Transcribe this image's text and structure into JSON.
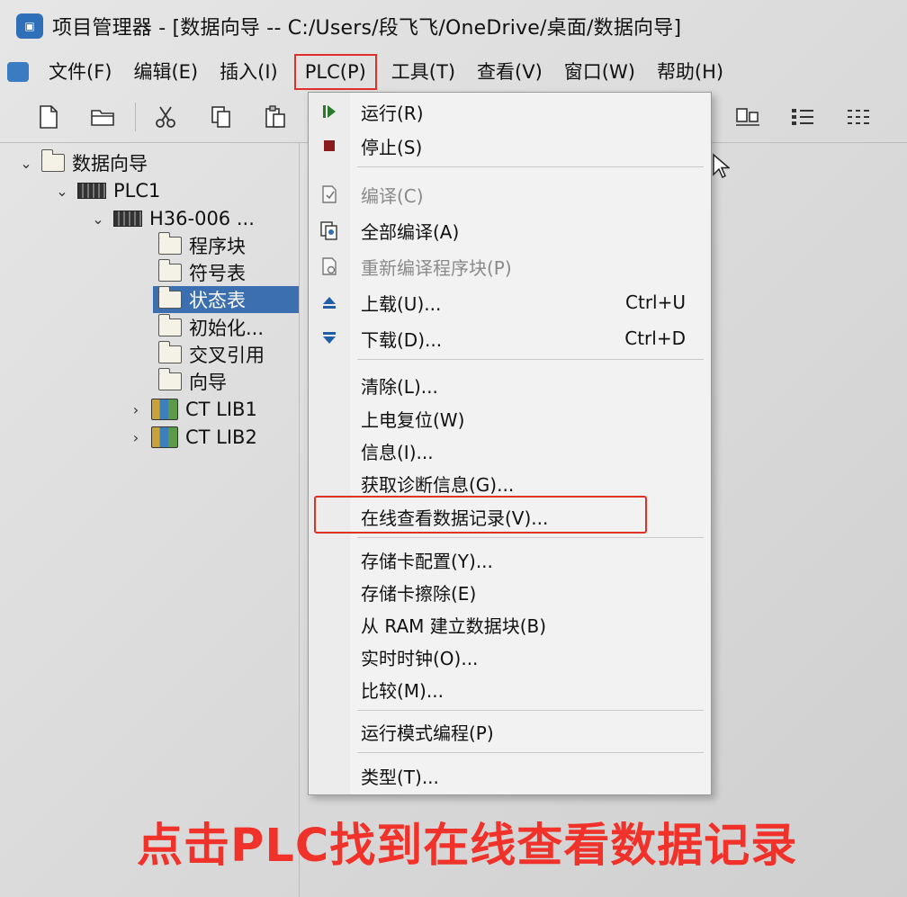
{
  "window": {
    "title": "项目管理器 - [数据向导 -- C:/Users/段飞飞/OneDrive/桌面/数据向导]"
  },
  "menubar": {
    "items": [
      "文件(F)",
      "编辑(E)",
      "插入(I)",
      "PLC(P)",
      "工具(T)",
      "查看(V)",
      "窗口(W)",
      "帮助(H)"
    ],
    "highlighted_item": "PLC(P)"
  },
  "toolbar": {
    "buttons": [
      "new-file-icon",
      "open-folder-icon",
      "cut-icon",
      "copy-icon",
      "paste-icon",
      "tile-view-icon",
      "list-view-icon",
      "details-view-icon"
    ]
  },
  "tree": {
    "items": [
      {
        "label": "数据向导",
        "icon": "folder-icon",
        "expander": "chevron-down-icon"
      },
      {
        "label": "PLC1",
        "icon": "plc-icon",
        "expander": "chevron-down-icon"
      },
      {
        "label": "H36-006 ...",
        "icon": "plc-icon",
        "expander": "chevron-down-icon"
      },
      {
        "label": "程序块",
        "icon": "folder-icon"
      },
      {
        "label": "符号表",
        "icon": "folder-icon"
      },
      {
        "label": "状态表",
        "icon": "folder-icon",
        "selected": true
      },
      {
        "label": "初始化...",
        "icon": "folder-icon"
      },
      {
        "label": "交叉引用",
        "icon": "folder-icon"
      },
      {
        "label": "向导",
        "icon": "folder-icon"
      },
      {
        "label": "CT LIB1",
        "icon": "library-icon",
        "expander": "chevron-right-icon"
      },
      {
        "label": "CT LIB2",
        "icon": "library-icon",
        "expander": "chevron-right-icon"
      }
    ]
  },
  "plc_menu": {
    "items": [
      {
        "label": "运行(R)",
        "icon": "run-icon"
      },
      {
        "label": "停止(S)",
        "icon": "stop-icon"
      },
      {
        "label": "编译(C)",
        "icon": "compile-icon",
        "disabled": true
      },
      {
        "label": "全部编译(A)",
        "icon": "compile-all-icon"
      },
      {
        "label": "重新编译程序块(P)",
        "icon": "recompile-icon",
        "disabled": true
      },
      {
        "label": "上载(U)...",
        "icon": "upload-icon",
        "shortcut": "Ctrl+U"
      },
      {
        "label": "下载(D)...",
        "icon": "download-icon",
        "shortcut": "Ctrl+D"
      },
      {
        "label": "清除(L)..."
      },
      {
        "label": "上电复位(W)"
      },
      {
        "label": "信息(I)..."
      },
      {
        "label": "获取诊断信息(G)..."
      },
      {
        "label": "在线查看数据记录(V)...",
        "highlighted": true
      },
      {
        "label": "存储卡配置(Y)..."
      },
      {
        "label": "存储卡擦除(E)"
      },
      {
        "label": "从 RAM 建立数据块(B)"
      },
      {
        "label": "实时时钟(O)..."
      },
      {
        "label": "比较(M)..."
      },
      {
        "label": "运行模式编程(P)"
      },
      {
        "label": "类型(T)..."
      }
    ]
  },
  "caption": "点击PLC找到在线查看数据记录",
  "colors": {
    "highlight_red": "#e0302a",
    "selection_blue": "#3c6fb0",
    "caption_red": "#f0322a"
  }
}
